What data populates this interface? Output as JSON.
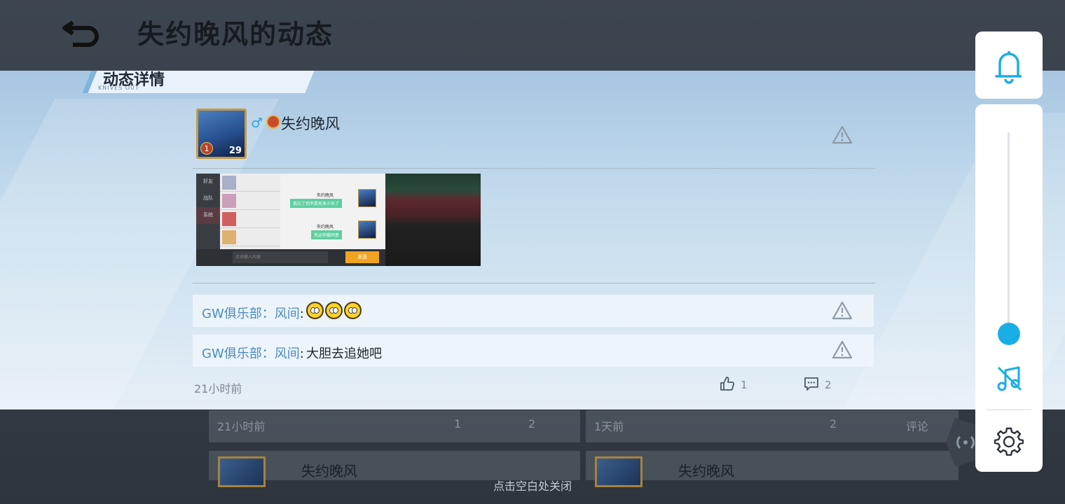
{
  "page": {
    "title": "失约晚风的动态",
    "close_hint": "点击空白处关闭"
  },
  "background_feed": {
    "cards": [
      {
        "time": "21小时前",
        "likes": "1",
        "comments": "2",
        "author": "失约晚风"
      },
      {
        "time": "1天前",
        "likes": "2",
        "comments": "评论",
        "author": "失约晚风"
      }
    ]
  },
  "modal": {
    "tab_title": "动态详情",
    "tab_subtitle": "KNIVES OUT",
    "post": {
      "author": "失约晚风",
      "avatar_level": "1",
      "avatar_number": "29",
      "time": "21小时前",
      "likes": "1",
      "comments": "2"
    },
    "screenshot": {
      "nav": [
        "好友",
        "战队",
        "系统"
      ],
      "send_label": "发送",
      "input_placeholder": "点击输入内容",
      "chat_name": "失约晚风",
      "bubble1": "我忘了到不是有多少天了",
      "bubble2": "凭运你做同意"
    },
    "comments": [
      {
        "author": "GW俱乐部",
        "sep": "：",
        "target": "风间",
        "colon": ":",
        "text": "",
        "emoji_count": 3
      },
      {
        "author": "GW俱乐部",
        "sep": "：",
        "target": "风间",
        "colon": ":",
        "text": "大胆去追她吧"
      }
    ]
  },
  "icons": {
    "back": "back-arrow-icon",
    "bell": "bell-icon",
    "music_off": "music-off-icon",
    "settings": "gear-icon",
    "report": "warning-triangle-icon",
    "like": "thumbs-up-icon",
    "comment": "comment-bubble-icon",
    "gender": "male-icon",
    "broadcast": "broadcast-icon"
  },
  "colors": {
    "accent": "#1aaee6",
    "link": "#4a8bbf",
    "modal_top": "#a7c6e2"
  }
}
